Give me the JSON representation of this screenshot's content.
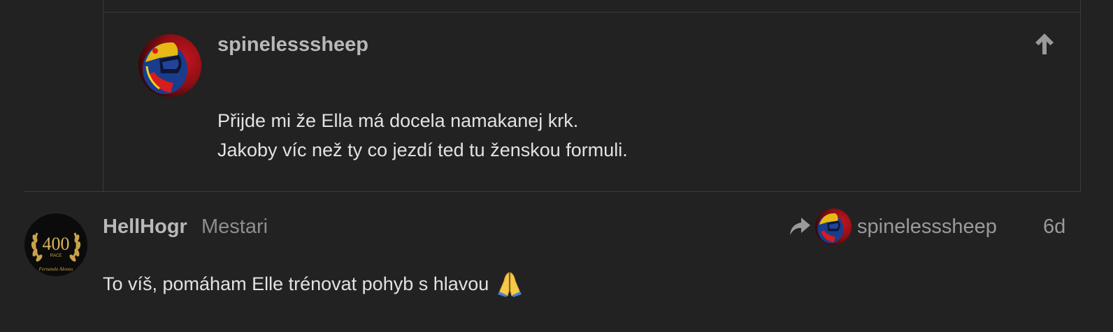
{
  "quoted_post": {
    "username": "spinelesssheep",
    "avatar_icon": "racing-helmet-avatar",
    "jump_icon": "arrow-up-icon",
    "lines": [
      "Přijde mi že Ella má docela namakanej krk.",
      "Jakoby víc než ty co jezdí ted tu ženskou formuli."
    ]
  },
  "post": {
    "username": "HellHogr",
    "user_title": "Mestari",
    "avatar_icon": "laurel-400-race-badge-avatar",
    "reply_to": {
      "icon": "reply-arrow-icon",
      "username": "spinelesssheep"
    },
    "date": "6d",
    "text": "To víš, pomáham Elle trénovat pohyb s hlavou",
    "emoji": "folded-hands-emoji"
  },
  "colors": {
    "background": "#222222",
    "divider": "#3a3a3a",
    "username": "#b8b8b8",
    "muted": "#8e8e8e",
    "text": "#e2e2e2"
  }
}
